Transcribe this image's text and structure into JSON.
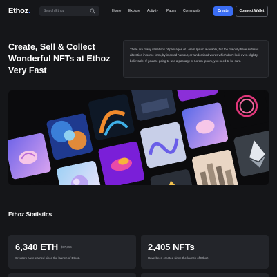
{
  "header": {
    "logo_text": "Ethoz",
    "logo_dot": ".",
    "search": {
      "placeholder": "Search Ethoz"
    },
    "nav": [
      "Home",
      "Explore",
      "Activity",
      "Pages",
      "Community"
    ],
    "create_label": "Create",
    "wallet_label": "Connect Wallet"
  },
  "hero": {
    "title": "Create, Sell & Collect Wonderful NFTs at Ethoz Very Fast",
    "description": "There are many variations of passages of Lorem Ipsum available, but the majority have suffered alteration in some form, by injected humour, or randomised words which don't look even slightly believable. If you are going to use a passage of Lorem Ipsum, you need to be sure."
  },
  "stats": {
    "title": "Ethoz Statistics",
    "cards": [
      {
        "value": "6,340 ETH",
        "usd": "$97,356",
        "caption": "Creators have earned since the launch of Ethoz."
      },
      {
        "value": "2,405 NFTs",
        "usd": "",
        "caption": "Have been created since the launch of Ethoz."
      }
    ]
  },
  "colors": {
    "accent": "#3b6ef5",
    "background": "#151619",
    "card": "#23252a"
  }
}
